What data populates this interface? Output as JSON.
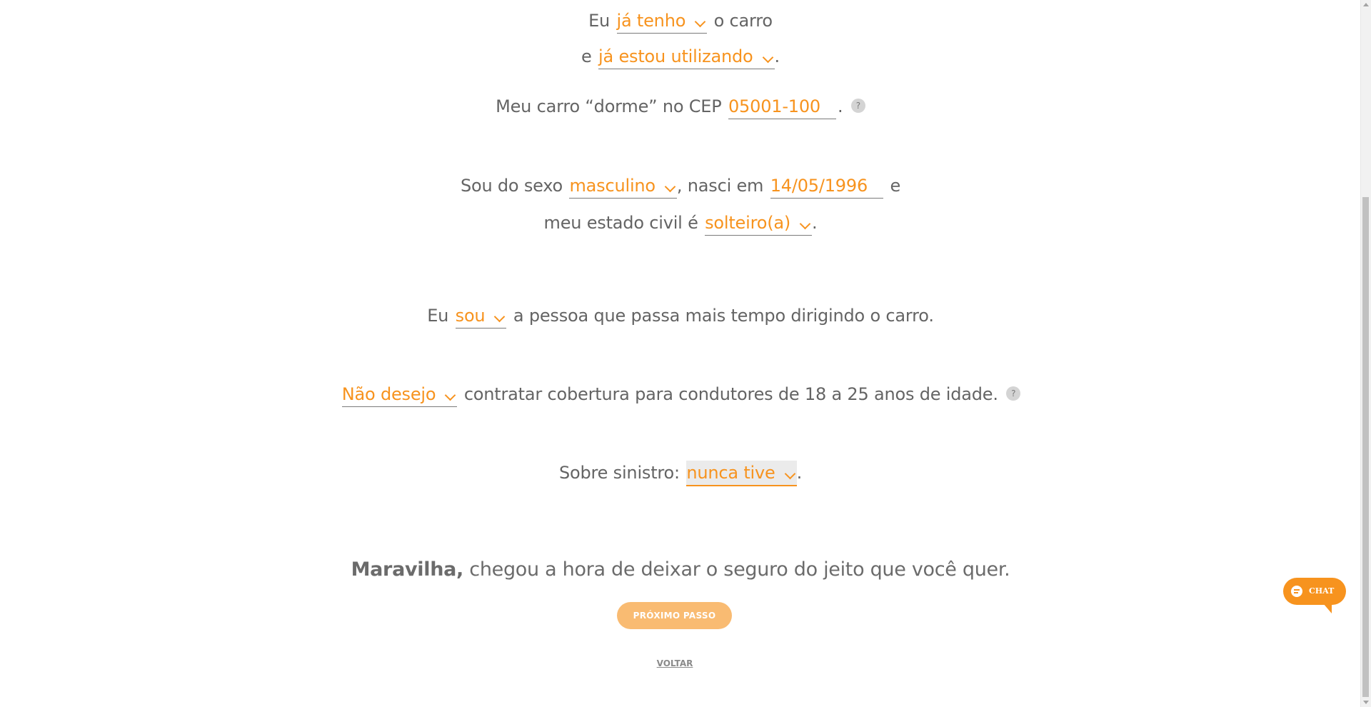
{
  "car_line": {
    "prefix": "Eu",
    "ownership_select": "já tenho",
    "suffix": "o carro"
  },
  "usage_line": {
    "prefix": "e",
    "usage_select": "já estou utilizando",
    "suffix": "."
  },
  "cep_line": {
    "prefix": "Meu carro “dorme” no CEP",
    "cep_value": "05001-100",
    "suffix": ".",
    "help": "?"
  },
  "sex_line": {
    "prefix": "Sou do sexo",
    "sex_select": "masculino",
    "middle": ", nasci em",
    "birth_date": "14/05/1996",
    "suffix": "e"
  },
  "civil_line": {
    "prefix": "meu estado civil é",
    "civil_select": "solteiro(a)",
    "suffix": "."
  },
  "driver_line": {
    "prefix": "Eu",
    "driver_select": "sou",
    "suffix": "a pessoa que passa mais tempo dirigindo o carro."
  },
  "coverage_line": {
    "coverage_select": "Não desejo",
    "suffix": "contratar cobertura para condutores de 18 a 25 anos de idade.",
    "help": "?"
  },
  "claim_line": {
    "prefix": "Sobre sinistro:",
    "claim_select": "nunca tive",
    "suffix": "."
  },
  "headline": {
    "bold": "Maravilha,",
    "rest": "chegou a hora de deixar o seguro do jeito que você quer."
  },
  "buttons": {
    "next": "PRÓXIMO PASSO",
    "back": "VOLTAR"
  },
  "chat": {
    "label": "CHAT",
    "icon": "chat-bubble-icon"
  },
  "colors": {
    "accent": "#f7931e",
    "button_bg": "#f9bb72",
    "text": "#646464"
  }
}
